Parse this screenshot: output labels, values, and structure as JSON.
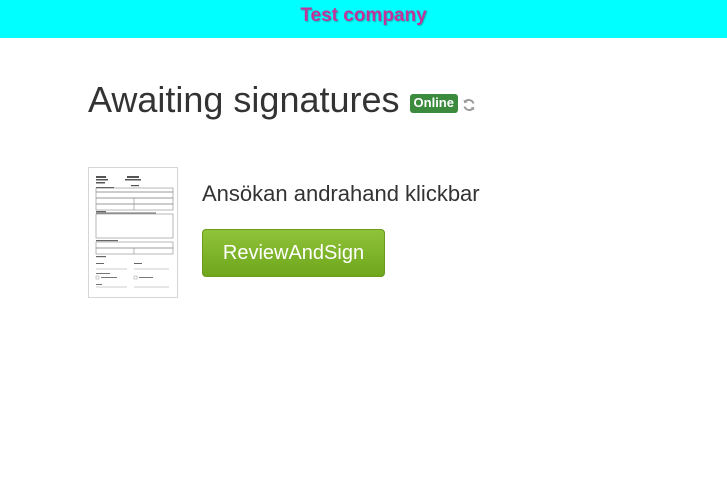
{
  "header": {
    "company_name": "Test company"
  },
  "main": {
    "title": "Awaiting signatures",
    "status_badge": "Online",
    "refresh_icon": "refresh-icon"
  },
  "documents": [
    {
      "name": "Ansökan andrahand klickbar",
      "action_label": "ReviewAndSign",
      "thumbnail_icon": "document-thumbnail"
    }
  ],
  "colors": {
    "header_bg": "#00ffff",
    "company_text": "#c2349b",
    "badge_bg": "#3b8a3e",
    "button_bg": "#7db32a"
  }
}
